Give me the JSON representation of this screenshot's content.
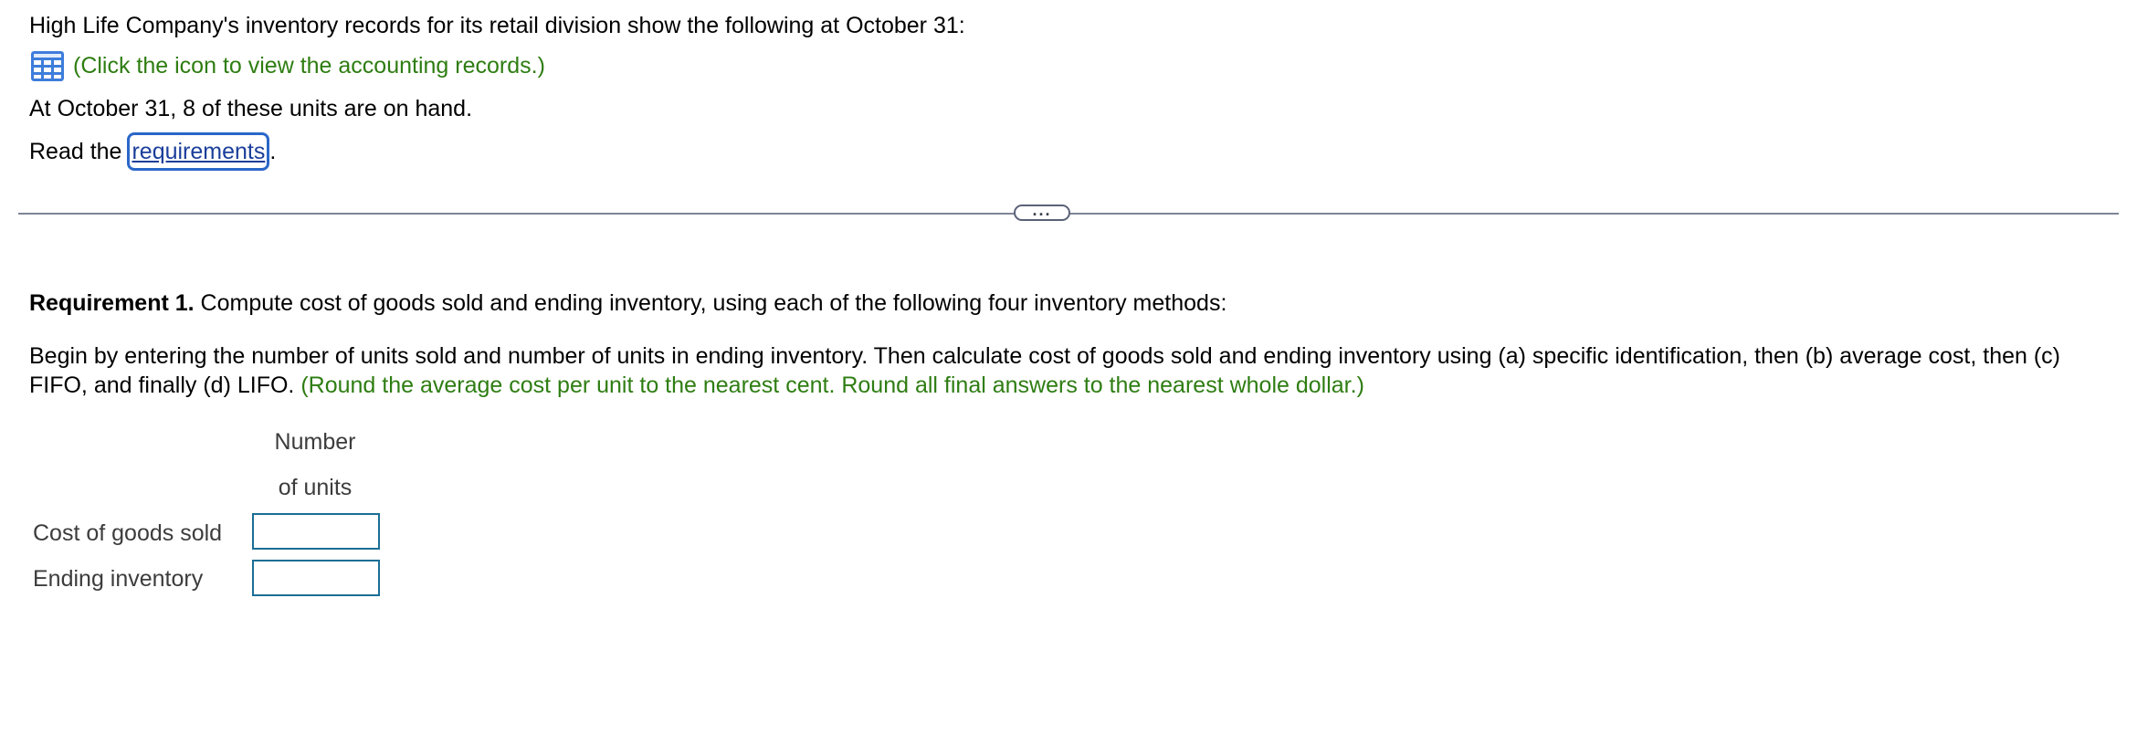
{
  "intro": {
    "line1": "High Life Company's inventory records for its retail division show the following at October 31:",
    "icon_link_text": "(Click the icon to view the accounting records.)",
    "icon": "table-grid-icon",
    "line3": "At October 31, 8 of these units are on hand.",
    "read_prefix": "Read the ",
    "requirements_link": "requirements",
    "read_suffix": "."
  },
  "divider": {
    "handle_label": "..."
  },
  "requirement1": {
    "label": "Requirement 1.",
    "text": " Compute cost of goods sold and ending inventory, using each of the following four inventory methods:"
  },
  "instructions": {
    "text": "Begin by entering the number of units sold and number of units in ending inventory. Then calculate cost of goods sold and ending inventory using (a) specific identification, then (b) average cost, then (c) FIFO, and finally (d) LIFO.",
    "rounding_note": "(Round the average cost per unit to the nearest cent. Round all final answers to the nearest whole dollar.)"
  },
  "table": {
    "header_line1": "Number",
    "header_line2": "of units",
    "rows": [
      {
        "label": "Cost of goods sold",
        "value": ""
      },
      {
        "label": "Ending inventory",
        "value": ""
      }
    ]
  },
  "colors": {
    "green_hint": "#2e7d12",
    "link_border": "#2a67c8",
    "input_border": "#1b6e95",
    "icon_blue": "#3d7ddb"
  }
}
